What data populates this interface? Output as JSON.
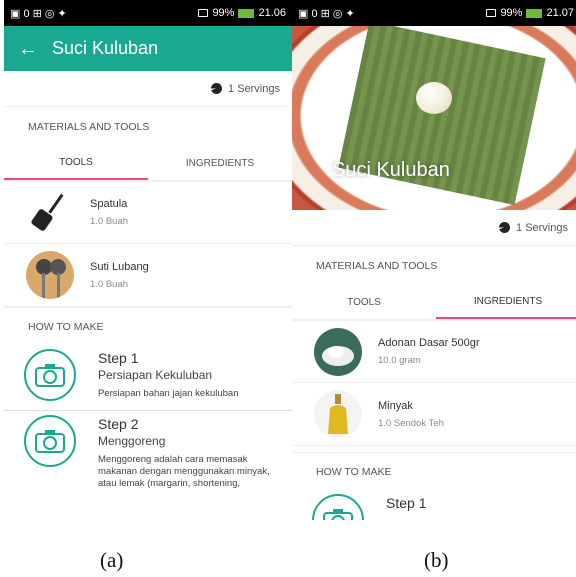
{
  "panel_a": {
    "status": {
      "left": "▣ 0 ⊞ ◎ ✦",
      "right": "99%",
      "time": "21.06"
    },
    "appbar": {
      "title": "Suci Kuluban"
    },
    "servings": "1 Servings",
    "materials_label": "MATERIALS AND TOOLS",
    "tabs": [
      {
        "label": "TOOLS"
      },
      {
        "label": "INGREDIENTS"
      }
    ],
    "items": [
      {
        "name": "Spatula",
        "qty": "1.0 Buah"
      },
      {
        "name": "Suti Lubang",
        "qty": "1.0 Buah"
      }
    ],
    "howto_label": "HOW TO MAKE",
    "steps": [
      {
        "title": "Step 1",
        "name": "Persiapan Kekuluban",
        "desc": "Persiapan bahan jajan kekuluban"
      },
      {
        "title": "Step 2",
        "name": "Menggoreng",
        "desc": "Menggoreng adalah cara memasak makanan dengan menggunakan minyak, atau lemak (margarin, shortening,"
      }
    ]
  },
  "panel_b": {
    "status": {
      "left": "▣ 0 ⊞ ◎ ✦",
      "right": "99%",
      "time": "21.07"
    },
    "hero_title": "Suci Kuluban",
    "servings": "1 Servings",
    "materials_label": "MATERIALS AND TOOLS",
    "tabs": [
      {
        "label": "TOOLS"
      },
      {
        "label": "INGREDIENTS"
      }
    ],
    "items": [
      {
        "name": "Adonan Dasar 500gr",
        "qty": "10.0 gram"
      },
      {
        "name": "Minyak",
        "qty": "1.0 Sendok Teh"
      }
    ],
    "howto_label": "HOW TO MAKE",
    "steps": [
      {
        "title": "Step 1"
      }
    ]
  },
  "captions": [
    "(a)",
    "(b)"
  ],
  "colors": {
    "accent": "#1aa891",
    "tab_indicator": "#e74c7c"
  }
}
